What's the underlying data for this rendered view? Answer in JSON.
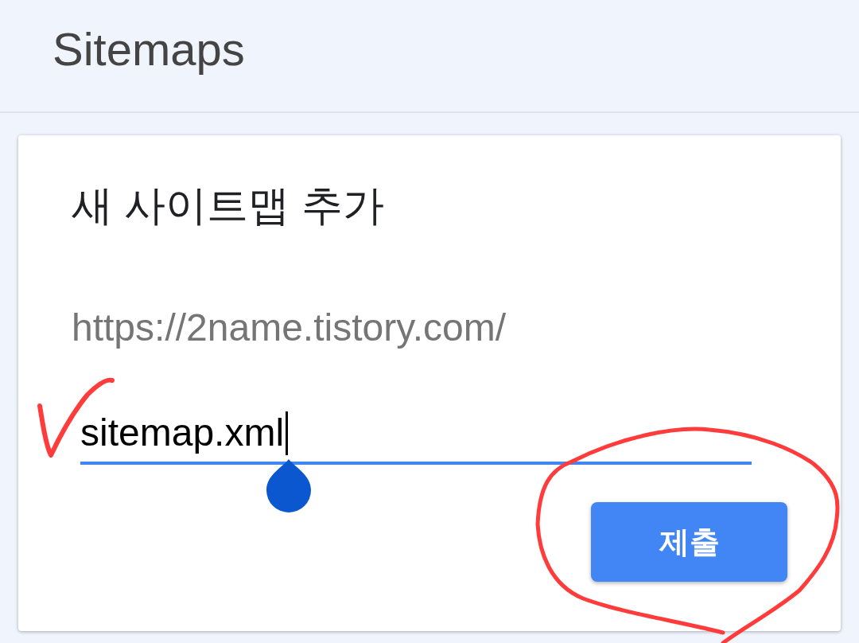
{
  "header": {
    "title": "Sitemaps"
  },
  "card": {
    "title": "새 사이트맵 추가",
    "url_prefix": "https://2name.tistory.com/",
    "input": {
      "value": "sitemap.xml",
      "focused": true
    },
    "submit_button": {
      "label": "제출"
    }
  }
}
